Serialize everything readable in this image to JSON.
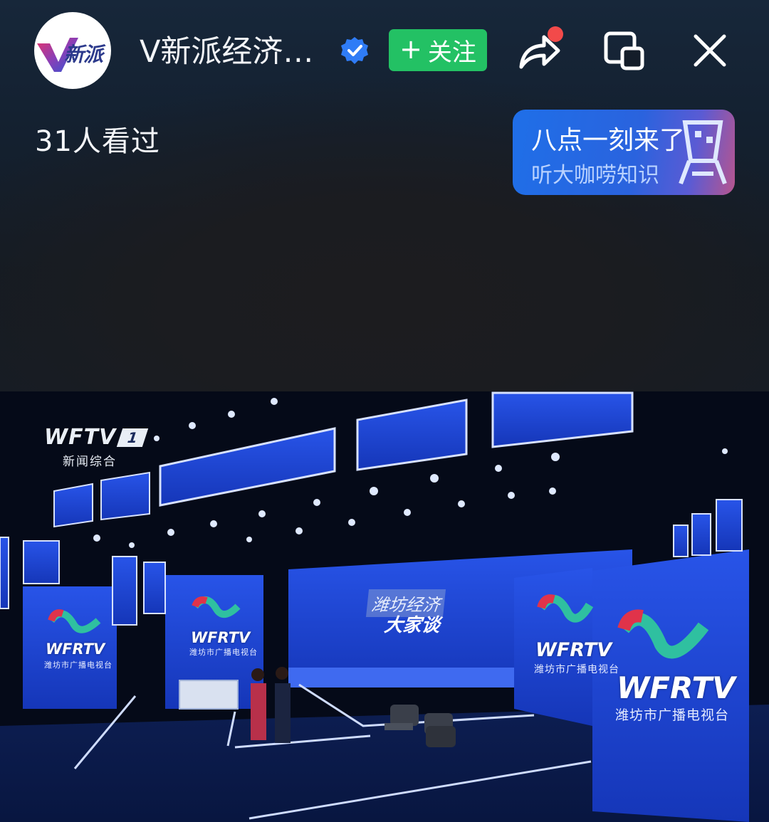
{
  "header": {
    "account_name": "V新派经济…",
    "follow_label": "关注",
    "follow_plus": "+",
    "avatar_text": "新派",
    "icons": {
      "verified": "verified-badge-icon",
      "share": "share-arrow-icon",
      "pip": "picture-in-picture-icon",
      "close": "close-icon"
    }
  },
  "stats": {
    "view_count": "31人看过"
  },
  "promo": {
    "title": "八点一刻来了",
    "subtitle": "听大咖唠知识"
  },
  "video": {
    "channel_logo": "WFTV",
    "channel_number": "1",
    "channel_name": "新闻综合",
    "screens": [
      {
        "logo": "WFRTV",
        "caption": "潍坊市广播电视台"
      },
      {
        "logo": "WFRTV",
        "caption": "潍坊市广播电视台"
      },
      {
        "logo": "WFRTV",
        "caption": "潍坊市广播电视台"
      },
      {
        "logo": "WFRTV",
        "caption": "潍坊市广播电视台"
      }
    ],
    "show_title_line1": "潍坊经济",
    "show_title_line2": "大家谈"
  },
  "colors": {
    "follow_green": "#23c164",
    "verified_blue": "#2f7cf6",
    "share_dot_red": "#f24a4a",
    "promo_blue": "#1f6fe8",
    "stage_blue": "#1f49d6"
  }
}
